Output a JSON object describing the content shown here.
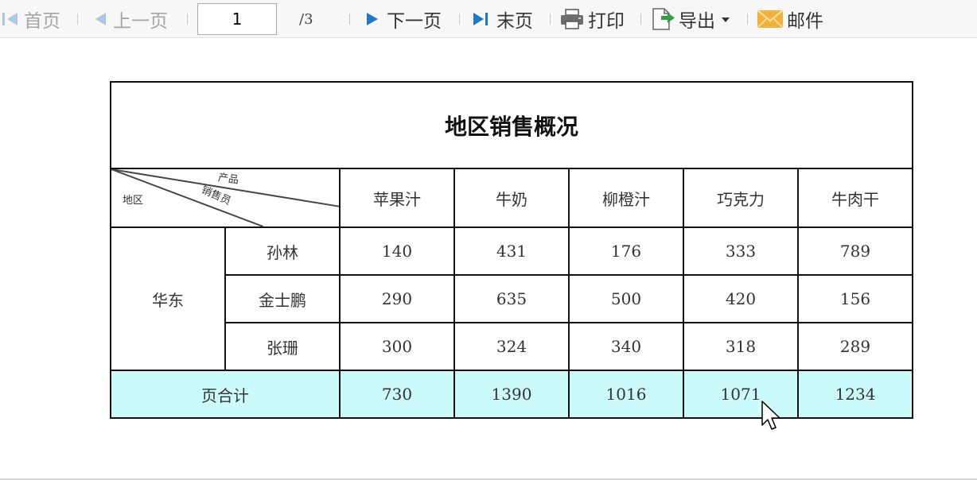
{
  "toolbar": {
    "first_label": "首页",
    "prev_label": "上一页",
    "page_value": "1",
    "page_total": "/3",
    "next_label": "下一页",
    "last_label": "末页",
    "print_label": "打印",
    "export_label": "导出",
    "mail_label": "邮件",
    "icons": {
      "first": "first-page-icon",
      "prev": "prev-page-icon",
      "next": "next-page-icon",
      "last": "last-page-icon",
      "print": "printer-icon",
      "export": "export-icon",
      "mail": "envelope-icon"
    },
    "colors": {
      "disabled_text": "#a6a6a6",
      "nav_arrow_disabled": "#a9c7e6",
      "nav_arrow_enabled": "#1f78c8",
      "mail_icon": "#f2b13c",
      "export_arrow": "#2ea043"
    }
  },
  "report": {
    "title": "地区销售概况",
    "header": {
      "diag_region": "地区",
      "diag_product": "产品",
      "diag_seller": "销售员",
      "products": [
        "苹果汁",
        "牛奶",
        "柳橙汁",
        "巧克力",
        "牛肉干"
      ]
    },
    "region": "华东",
    "rows": [
      {
        "seller": "孙林",
        "values": [
          "140",
          "431",
          "176",
          "333",
          "789"
        ]
      },
      {
        "seller": "金士鹏",
        "values": [
          "290",
          "635",
          "500",
          "420",
          "156"
        ]
      },
      {
        "seller": "张珊",
        "values": [
          "300",
          "324",
          "340",
          "318",
          "289"
        ]
      }
    ],
    "total": {
      "label": "页合计",
      "values": [
        "730",
        "1390",
        "1016",
        "1071",
        "1234"
      ]
    },
    "colors": {
      "total_row_bg": "#ccfbfb",
      "border": "#111111"
    }
  }
}
